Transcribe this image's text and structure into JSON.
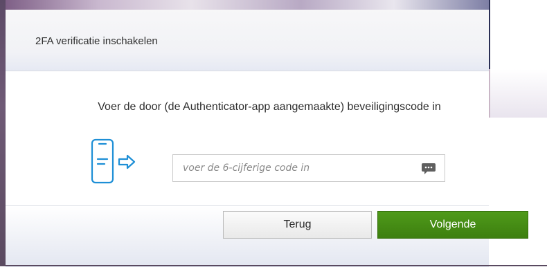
{
  "dialog": {
    "title": "2FA verificatie inschakelen",
    "instruction": "Voer de door (de Authenticator-app aangemaakte) beveiligingscode in"
  },
  "code_input": {
    "placeholder": "voer de 6-cijferige code in",
    "value": ""
  },
  "buttons": {
    "back_label": "Terug",
    "next_label": "Volgende"
  },
  "icons": {
    "phone": "phone-arrow-icon",
    "sms": "sms-message-icon"
  },
  "colors": {
    "accent_blue": "#1e8fd6",
    "primary_green": "#4a8f17"
  }
}
